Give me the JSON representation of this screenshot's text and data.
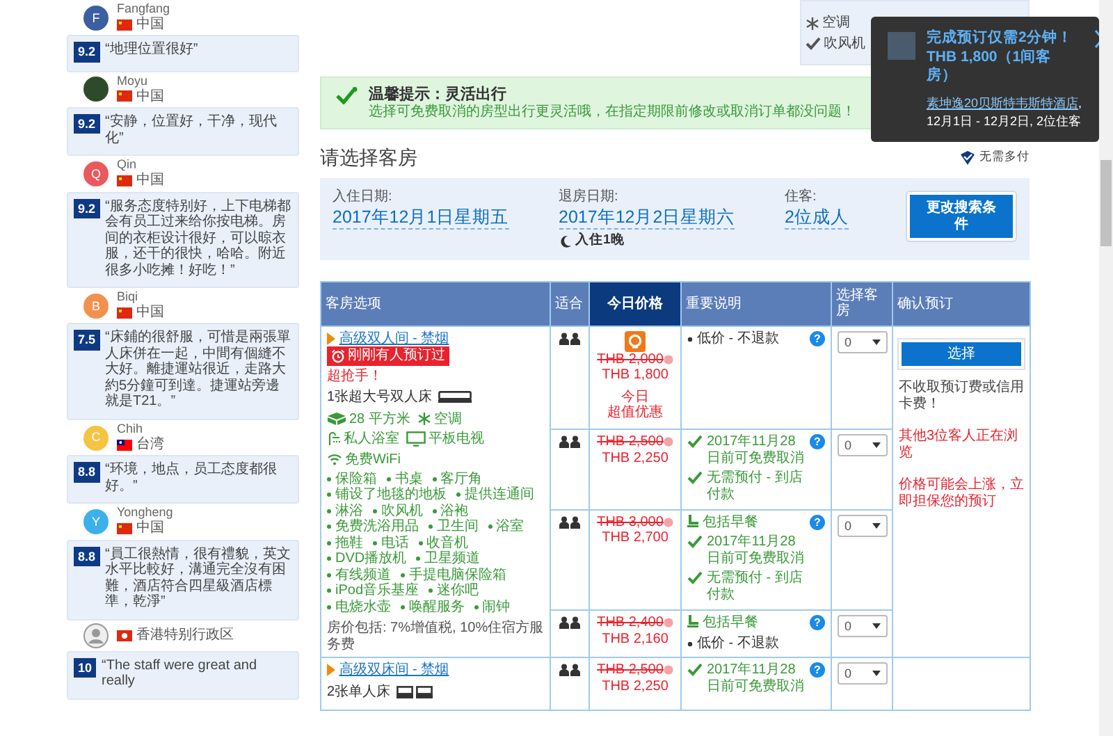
{
  "reviews": [
    {
      "reviewer": {
        "name": "Fangfang",
        "country": "中国",
        "flag": {
          "kind": "cn"
        },
        "avatar": {
          "kind": "initial",
          "initial": "F",
          "color": "#3b5fa0"
        }
      }
    },
    {
      "score": "9.2",
      "quote": "“地理位置很好”",
      "reviewer": {
        "name": "Moyu",
        "country": "中国",
        "flag": {
          "kind": "cn"
        },
        "avatar": {
          "kind": "photo"
        }
      }
    },
    {
      "score": "9.2",
      "quote": "“安静，位置好，干净，现代化”",
      "reviewer": {
        "name": "Qin",
        "country": "中国",
        "flag": {
          "kind": "cn"
        },
        "avatar": {
          "kind": "initial",
          "initial": "Q",
          "color": "#e85a5f"
        }
      }
    },
    {
      "score": "9.2",
      "quote": "“服务态度特别好，上下电梯都会有员工过来给你按电梯。房间的衣柜设计很好，可以晾衣服，还干的很快，哈哈。附近很多小吃摊！好吃！”",
      "reviewer": {
        "name": "Biqi",
        "country": "中国",
        "flag": {
          "kind": "cn"
        },
        "avatar": {
          "kind": "initial",
          "initial": "B",
          "color": "#f2914d"
        }
      }
    },
    {
      "score": "7.5",
      "quote": "“床鋪的很舒服，可惜是兩張單人床併在一起，中間有個縫不大好。離捷運站很近，走路大約5分鐘可到達。捷運站旁邊就是T21。”",
      "reviewer": {
        "name": "Chih",
        "country": "台湾",
        "flag": {
          "kind": "tw"
        },
        "avatar": {
          "kind": "initial",
          "initial": "C",
          "color": "#f6c443"
        }
      }
    },
    {
      "score": "8.8",
      "quote": "“环境，地点，员工态度都很好。”",
      "reviewer": {
        "name": "Yongheng",
        "country": "中国",
        "flag": {
          "kind": "cn"
        },
        "avatar": {
          "kind": "initial",
          "initial": "Y",
          "color": "#3cb1e9"
        }
      }
    },
    {
      "score": "8.8",
      "quote": "“員工很熱情，很有禮貌，英文水平比較好，溝通完全沒有困難，酒店符合四星級酒店標準，乾淨”",
      "reviewer": {
        "country": "香港特别行政区",
        "flag": {
          "kind": "hk"
        },
        "avatar": {
          "kind": "silhouette"
        }
      }
    },
    {
      "score": "10",
      "quote": "“The staff were great and really"
    }
  ],
  "facilities_card": {
    "items": [
      {
        "kind": "aircon",
        "text": "空调"
      },
      {
        "kind": "check",
        "text": "吹风机"
      }
    ]
  },
  "popup": {
    "title": "完成预订仅需2分钟！THB 1,800（1间客房）",
    "hotel_link": "素坤逸20贝斯特韦斯特酒店",
    "details": ", 12月1日 - 12月2日, 2位住客"
  },
  "tip": {
    "title": "温馨提示：灵活出行",
    "text": "选择可免费取消的房型出行更灵活哦，在指定期限前修改或取消订单都没问题！"
  },
  "heading": "请选择客房",
  "no_extra_charge": "无需多付",
  "search": {
    "checkin_label": "入住日期:",
    "checkin": "2017年12月1日星期五",
    "checkout_label": "退房日期:",
    "checkout": "2017年12月2日星期六",
    "nights": "入住1晚",
    "guests_label": "住客:",
    "guests": "2位成人",
    "button": "更改搜索条件"
  },
  "table": {
    "columns": [
      {
        "label": "客房选项",
        "selected": false
      },
      {
        "label": "适合",
        "selected": false
      },
      {
        "label": "今日价格",
        "selected": true
      },
      {
        "label": "重要说明",
        "selected": false
      },
      {
        "label": "选择客房",
        "selected": false
      },
      {
        "label": "确认预订",
        "selected": false
      }
    ],
    "rooms": [
      {
        "name": "高级双人间 - 禁烟",
        "badge": "刚刚有人预订过",
        "hot": "超抢手！",
        "bed": {
          "text": "1张超大号双人床",
          "kind": "double"
        },
        "features": [
          {
            "kind": "size",
            "text": "28 平方米"
          },
          {
            "kind": "aircon",
            "text": "空调"
          },
          {
            "kind": "bath",
            "text": "私人浴室"
          },
          {
            "kind": "tv",
            "text": "平板电视"
          },
          {
            "kind": "wifi",
            "text": "免费WiFi"
          }
        ],
        "amenities": [
          "保险箱",
          "书桌",
          "客厅角",
          "铺设了地毯的地板",
          "提供连通间",
          "淋浴",
          "吹风机",
          "浴袍",
          "免费洗浴用品",
          "卫生间",
          "浴室",
          "拖鞋",
          "电话",
          "收音机",
          "DVD播放机",
          "卫星频道",
          "有线频道",
          "手提电脑保险箱",
          "iPod音乐基座",
          "迷你吧",
          "电烧水壶",
          "唤醒服务",
          "闹钟"
        ],
        "price_includes": "房价包括: 7%增值税, 10%住宿方服务费",
        "confirm": {
          "button": "选择",
          "note": "不收取预订费或信用卡费！",
          "viewers": "其他3位客人正在浏览",
          "urgency": "价格可能会上涨，立即担保您的预订"
        },
        "offers": [
          {
            "old_price": "THB 2,000",
            "price": "THB 1,800",
            "deal_lines": [
              "今日",
              "超值优惠"
            ],
            "notes": [
              {
                "kind": "bullet",
                "text": "低价 - 不退款"
              }
            ],
            "help": "?",
            "rooms": "0"
          },
          {
            "old_price": "THB 2,500",
            "price": "THB 2,250",
            "notes": [
              {
                "kind": "check",
                "text": "2017年11月28日前可免费取消"
              },
              {
                "kind": "check",
                "text": "无需预付 - 到店付款"
              }
            ],
            "help": "?",
            "rooms": "0"
          },
          {
            "old_price": "THB 3,000",
            "price": "THB 2,700",
            "notes": [
              {
                "kind": "breakfast",
                "text": "包括早餐"
              },
              {
                "kind": "check",
                "text": "2017年11月28日前可免费取消"
              },
              {
                "kind": "check",
                "text": "无需预付 - 到店付款"
              }
            ],
            "help": "?",
            "rooms": "0"
          },
          {
            "old_price": "THB 2,400",
            "price": "THB 2,160",
            "notes": [
              {
                "kind": "breakfast",
                "text": "包括早餐"
              },
              {
                "kind": "bullet",
                "text": "低价 - 不退款"
              }
            ],
            "help": "?",
            "rooms": "0"
          }
        ]
      },
      {
        "name": "高级双床间 - 禁烟",
        "bed": {
          "text": "2张单人床",
          "kind": "twin"
        },
        "offers": [
          {
            "old_price": "THB 2,500",
            "price": "THB 2,250",
            "notes": [
              {
                "kind": "check",
                "text": "2017年11月28日前可免费取消"
              }
            ],
            "help": "?",
            "rooms": "0"
          }
        ]
      }
    ]
  }
}
